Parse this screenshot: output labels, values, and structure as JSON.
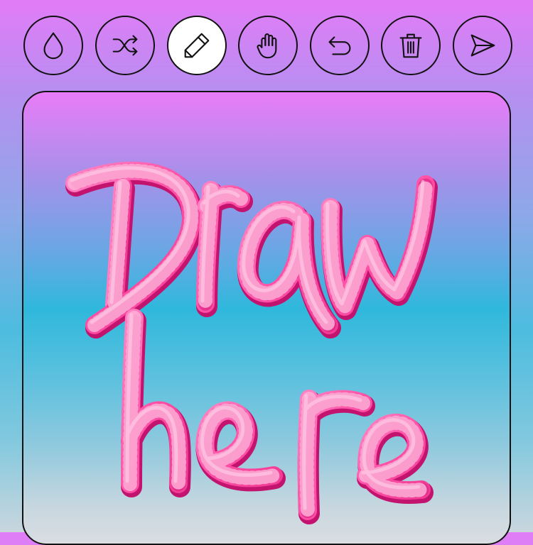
{
  "toolbar": {
    "tools": [
      {
        "name": "color",
        "icon": "droplet-icon",
        "active": false
      },
      {
        "name": "randomize",
        "icon": "shuffle-icon",
        "active": false
      },
      {
        "name": "draw",
        "icon": "pencil-icon",
        "active": true
      },
      {
        "name": "pan",
        "icon": "hand-icon",
        "active": false
      },
      {
        "name": "undo",
        "icon": "undo-icon",
        "active": false
      },
      {
        "name": "delete",
        "icon": "trash-icon",
        "active": false
      },
      {
        "name": "send",
        "icon": "send-icon",
        "active": false
      }
    ]
  },
  "canvas": {
    "drawn_text": "Draw here",
    "brush_color": "#ff5fae",
    "brush_style": "heart-tube"
  },
  "colors": {
    "background_top": "#e27cf7",
    "background_bottom": "#c9d6de",
    "border": "#111111",
    "active_button": "#ffffff",
    "brush": "#ff5fae"
  }
}
